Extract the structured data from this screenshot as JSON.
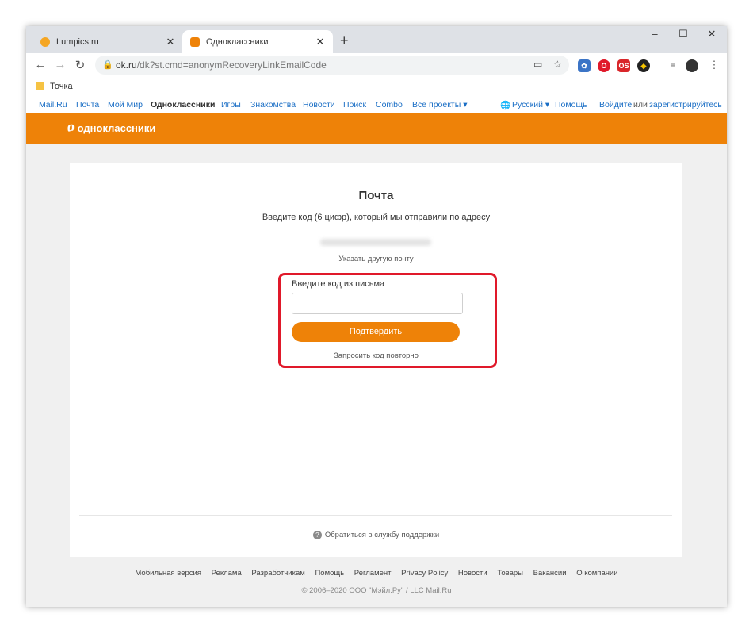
{
  "tabs": [
    {
      "title": "Lumpics.ru",
      "favicon_color": "#f5a623",
      "active": false
    },
    {
      "title": "Одноклассники",
      "favicon_color": "#ee8208",
      "active": true
    }
  ],
  "new_tab_symbol": "+",
  "window_controls": {
    "minimize": "–",
    "maximize": "☐",
    "close": "✕"
  },
  "address_bar": {
    "host": "ok.ru",
    "path": "/dk?st.cmd=anonymRecoveryLinkEmailCode"
  },
  "bookmarks": [
    {
      "label": "Точка"
    }
  ],
  "portal_nav": {
    "items": [
      "Mail.Ru",
      "Почта",
      "Мой Мир",
      "Одноклассники",
      "Игры",
      "Знакомства",
      "Новости",
      "Поиск",
      "Combo",
      "Все проекты ▾"
    ],
    "current_index": 3,
    "language": "Русский ▾",
    "help": "Помощь",
    "login": "Войдите",
    "or": "или",
    "register": "зарегистрируйтесь"
  },
  "header": {
    "logo_text": "одноклассники",
    "brand_color": "#ee8208"
  },
  "form": {
    "title": "Почта",
    "subtitle": "Введите код (6 цифр), который мы отправили по адресу",
    "change_email_link": "Указать другую почту",
    "code_label": "Введите код из письма",
    "code_value": "",
    "confirm_button": "Подтвердить",
    "resend_link": "Запросить код повторно",
    "highlight_color": "#e0192a"
  },
  "support_link": "Обратиться в службу поддержки",
  "footer": {
    "links": [
      "Мобильная версия",
      "Реклама",
      "Разработчикам",
      "Помощь",
      "Регламент",
      "Privacy Policy",
      "Новости",
      "Товары",
      "Вакансии",
      "О компании"
    ],
    "copyright": "© 2006–2020 ООО \"Мэйл.Ру\" / LLC Mail.Ru"
  }
}
